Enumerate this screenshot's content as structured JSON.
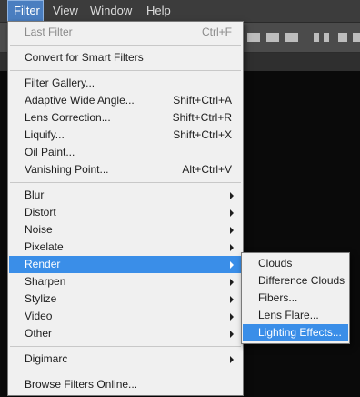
{
  "menubar": {
    "items": [
      "Filter",
      "View",
      "Window",
      "Help"
    ]
  },
  "filter_menu": {
    "last_filter": {
      "label": "Last Filter",
      "shortcut": "Ctrl+F"
    },
    "convert_smart": "Convert for Smart Filters",
    "group1": [
      {
        "label": "Filter Gallery...",
        "shortcut": ""
      },
      {
        "label": "Adaptive Wide Angle...",
        "shortcut": "Shift+Ctrl+A"
      },
      {
        "label": "Lens Correction...",
        "shortcut": "Shift+Ctrl+R"
      },
      {
        "label": "Liquify...",
        "shortcut": "Shift+Ctrl+X"
      },
      {
        "label": "Oil Paint...",
        "shortcut": ""
      },
      {
        "label": "Vanishing Point...",
        "shortcut": "Alt+Ctrl+V"
      }
    ],
    "submenus": [
      "Blur",
      "Distort",
      "Noise",
      "Pixelate",
      "Render",
      "Sharpen",
      "Stylize",
      "Video",
      "Other"
    ],
    "digimarc": "Digimarc",
    "browse_online": "Browse Filters Online..."
  },
  "render_submenu": {
    "items": [
      "Clouds",
      "Difference Clouds",
      "Fibers...",
      "Lens Flare...",
      "Lighting Effects..."
    ]
  },
  "colors": {
    "highlight": "#3a8ee8",
    "menu_bg": "#f0f0f0",
    "menubar_bg": "#3c3c3c"
  }
}
